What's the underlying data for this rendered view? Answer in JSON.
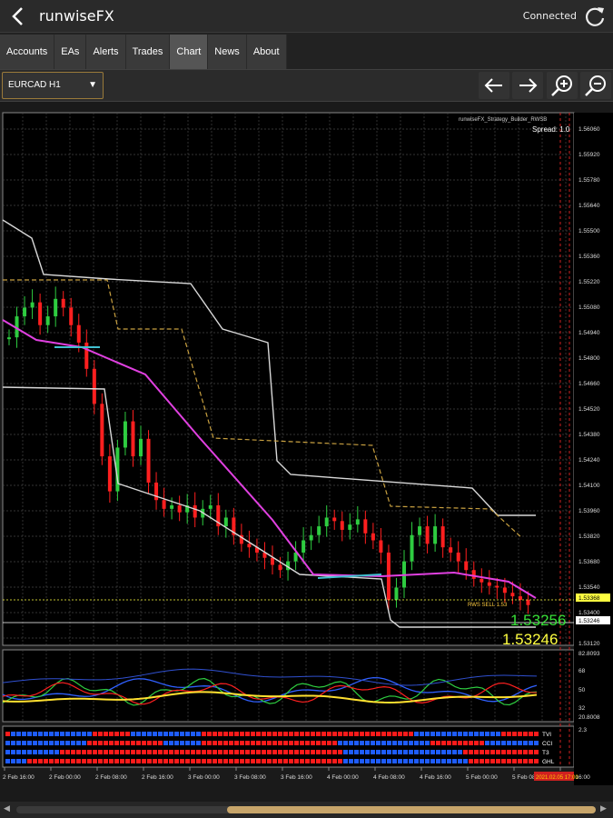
{
  "app": {
    "title": "runwiseFX",
    "status": "Connected"
  },
  "icons": {
    "back": "chevron-left-icon",
    "refresh": "refresh-icon",
    "arrow_left": "arrow-left-icon",
    "arrow_right": "arrow-right-icon",
    "zoom_in": "zoom-in-icon",
    "zoom_out": "zoom-out-icon",
    "dropdown": "chevron-down-icon"
  },
  "tabs": [
    {
      "label": "Accounts",
      "active": false
    },
    {
      "label": "EAs",
      "active": false
    },
    {
      "label": "Alerts",
      "active": false
    },
    {
      "label": "Trades",
      "active": false
    },
    {
      "label": "Chart",
      "active": true
    },
    {
      "label": "News",
      "active": false
    },
    {
      "label": "About",
      "active": false
    }
  ],
  "toolbar": {
    "symbol": "EURCAD H1"
  },
  "chart": {
    "indicator_label": "runwiseFX_Strategy_Builder_RWSB",
    "spread_label": "Spread: 1.0",
    "bid_price": "1.53256",
    "ask_price": "1.53246",
    "sell_label": "RWS SELL 1.53",
    "price_axis": [
      "1.56060",
      "1.55920",
      "1.55780",
      "1.55640",
      "1.55500",
      "1.55360",
      "1.55220",
      "1.55080",
      "1.54940",
      "1.54800",
      "1.54660",
      "1.54520",
      "1.54380",
      "1.54240",
      "1.54100",
      "1.53960",
      "1.53820",
      "1.53680",
      "1.53540",
      "1.53400",
      "1.53368",
      "1.53246",
      "1.53120"
    ],
    "osc_axis": [
      "82.8093",
      "68",
      "50",
      "32",
      "20.8008"
    ],
    "bars_axis": [
      "2.3"
    ],
    "bars_labels": [
      "TVI",
      "CCI",
      "T3",
      "GHL"
    ],
    "time_axis": [
      "2 Feb 16:00",
      "2 Feb 00:00",
      "2 Feb 08:00",
      "2 Feb 16:00",
      "3 Feb 00:00",
      "3 Feb 08:00",
      "3 Feb 16:00",
      "4 Feb 00:00",
      "4 Feb 08:00",
      "4 Feb 16:00",
      "5 Feb 00:00",
      "5 Feb 08:00",
      "5 Feb 16:00"
    ],
    "current_time": "2021.02.05 17:00",
    "colors": {
      "bull": "#2ecc40",
      "bear": "#ff1f1f",
      "ma": "#e040e0",
      "ma_alt": "#40c0d0",
      "channel": "#d8d8d8",
      "dashed": "#c8a040",
      "bid": "#38e038",
      "ask": "#ffff40"
    }
  }
}
